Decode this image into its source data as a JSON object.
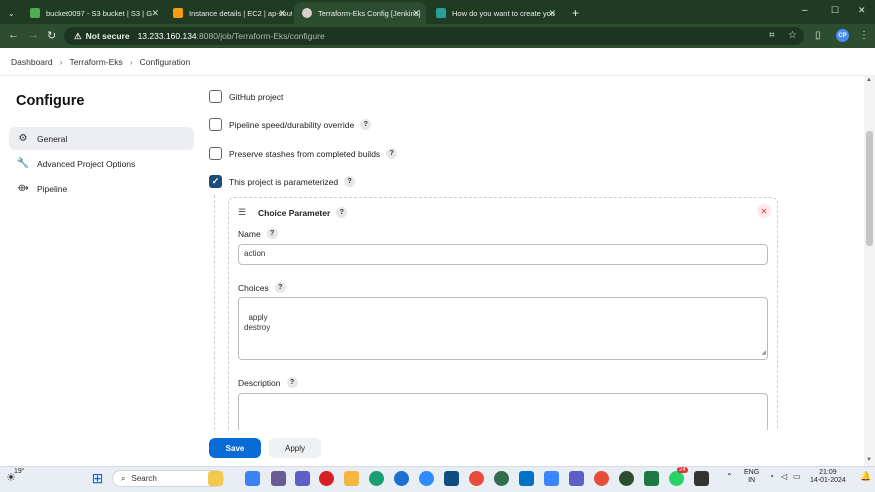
{
  "browser": {
    "tabs": [
      {
        "title": "bucket0097 - S3 bucket | S3 | G",
        "icon_color": "#4caf50",
        "active": false
      },
      {
        "title": "Instance details | EC2 | ap-south",
        "icon_color": "#f39c12",
        "active": false
      },
      {
        "title": "Terraform-Eks Config [Jenkins]",
        "icon_color": "#d9d0c7",
        "active": true
      },
      {
        "title": "How do you want to create you",
        "icon_color": "#2aa198",
        "active": false
      }
    ],
    "new_tab_glyph": "+",
    "not_secure": "Not secure",
    "url_host": "13.233.160.134",
    "url_path": ":8080/job/Terraform-Eks/configure",
    "avatar_initials": "CP"
  },
  "breadcrumb": [
    "Dashboard",
    "Terraform-Eks",
    "Configuration"
  ],
  "sidebar": {
    "title": "Configure",
    "items": [
      {
        "label": "General",
        "icon": "gear-icon",
        "active": true
      },
      {
        "label": "Advanced Project Options",
        "icon": "wrench-icon",
        "active": false
      },
      {
        "label": "Pipeline",
        "icon": "pipeline-icon",
        "active": false
      }
    ]
  },
  "options": [
    {
      "label": "GitHub project",
      "checked": false,
      "help": false
    },
    {
      "label": "Pipeline speed/durability override",
      "checked": false,
      "help": true
    },
    {
      "label": "Preserve stashes from completed builds",
      "checked": false,
      "help": true
    },
    {
      "label": "This project is parameterized",
      "checked": true,
      "help": true
    }
  ],
  "parameter": {
    "title": "Choice Parameter",
    "name_label": "Name",
    "name_value": "action",
    "choices_label": "Choices",
    "choices_value": "apply\ndestroy",
    "description_label": "Description",
    "description_value": ""
  },
  "buttons": {
    "save": "Save",
    "apply": "Apply"
  },
  "taskbar": {
    "weather": "19°",
    "search_placeholder": "Search",
    "lang": "ENG",
    "region": "IN",
    "time": "21:09",
    "date": "14-01-2024",
    "notification_count": "24"
  },
  "colors": {
    "accent": "#0b6bd6",
    "checkbox": "#1f4d7a",
    "browser_frame": "#2c4d2f"
  }
}
